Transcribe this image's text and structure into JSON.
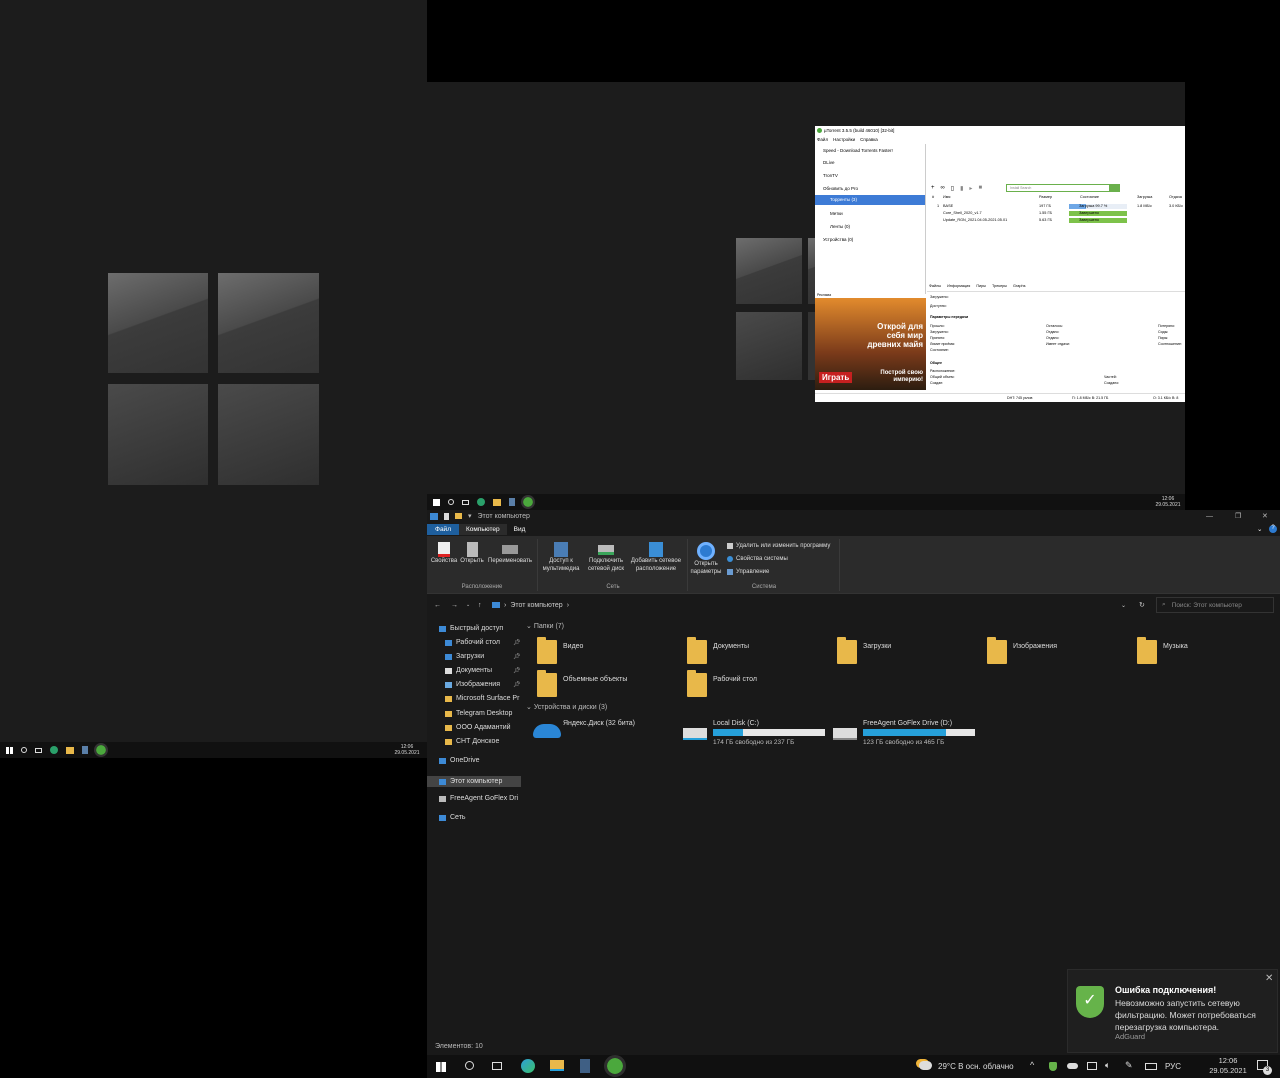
{
  "left_desktop": {
    "clock_time": "12:06",
    "clock_date": "29.05.2021"
  },
  "mid_desktop": {
    "clock_time": "12:06",
    "clock_date": "29.05.2021"
  },
  "utorrent": {
    "title": "µTorrent 3.5.5 (build 46010) [32-bit]",
    "menu": [
      "Файл",
      "Настройки",
      "Справка"
    ],
    "sidebar": [
      {
        "label": "Speed - Download Torrents Faster!",
        "icon": "speed-icon"
      },
      {
        "label": "DLive",
        "icon": "dlive-icon"
      },
      {
        "label": "TronTV",
        "icon": "trontv-icon"
      },
      {
        "label": "Обновить до Pro",
        "icon": "pro-icon"
      },
      {
        "label": "Торренты (3)",
        "icon": "torrents-icon",
        "selected": true
      },
      {
        "label": "Метки",
        "icon": "labels-icon"
      },
      {
        "label": "Ленты (0)",
        "icon": "feeds-icon"
      },
      {
        "label": "Устройства (0)",
        "icon": "devices-icon"
      }
    ],
    "ad_label": "Реклама",
    "search_placeholder": "Install Search",
    "columns": [
      "#",
      "Имя",
      "Размер",
      "Состояние",
      "Загрузка",
      "Отдача"
    ],
    "torrents": [
      {
        "num": "1",
        "name": "BASE",
        "size": "197 ГБ",
        "status": "Загрузка 99.7 %",
        "progress": 0.3,
        "down": "1.8 МБ/с",
        "up": "3.0 КБ/с",
        "color": "#6ea7e6"
      },
      {
        "num": "",
        "name": "Core_Shell_2020_v1.7",
        "size": "1.55 ГБ",
        "status": "Завершено",
        "progress": 1.0,
        "down": "",
        "up": "",
        "color": "#7dc24a"
      },
      {
        "num": "",
        "name": "Update_RGN_2021.04.05-2021.05.01",
        "size": "5.63 ГБ",
        "status": "Завершено",
        "progress": 1.0,
        "down": "",
        "up": "",
        "color": "#7dc24a"
      }
    ],
    "tabs": [
      "Файлы",
      "Информация",
      "Пиры",
      "Трекеры",
      "Graphs"
    ],
    "info_labels": {
      "downloaded": "Загружено:",
      "available": "Доступно:",
      "transfer_header": "Параметры передачи",
      "elapsed": "Прошло:",
      "downloaded2": "Загружено:",
      "received": "Принято:",
      "share_limit": "Лимит приёма:",
      "state": "Состояние:",
      "remaining": "Осталось:",
      "sent": "Отдано:",
      "wasted": "Отдано:",
      "seeds": "Имеет отдачи:",
      "uploaded": "Потеряно:",
      "seeds2": "Сиды:",
      "peers": "Пиры:",
      "ratio": "Соотношение:",
      "general_header": "Общее",
      "location": "Расположение:",
      "total_size": "Общий объем:",
      "created": "Создан:",
      "pieces": "Частей:",
      "created_by": "Создано:"
    },
    "ad_text": {
      "line1": "Открой для",
      "line2": "себя мир",
      "line3": "древних майя",
      "play": "Играть",
      "line4": "Построй свою",
      "line5": "империю!"
    },
    "status_bar": {
      "dht": "DHT: 745 узлов",
      "down": "П: 1.8 МБ/с В: 21.5 ГБ",
      "up": "О: 3.1 КБ/с В: 8"
    }
  },
  "explorer": {
    "title": "Этот компьютер",
    "ribbon_tabs": [
      "Файл",
      "Компьютер",
      "Вид"
    ],
    "ribbon_groups": [
      {
        "name": "Расположение",
        "buttons": [
          "Свойства",
          "Открыть",
          "Переименовать"
        ]
      },
      {
        "name": "Сеть",
        "buttons": [
          "Доступ к мультимедиа",
          "Подключить сетевой диск",
          "Добавить сетевое расположение"
        ]
      },
      {
        "name": "Система",
        "buttons": [
          "Открыть параметры"
        ],
        "links": [
          "Удалить или изменить программу",
          "Свойства системы",
          "Управление"
        ]
      }
    ],
    "address": "Этот компьютер",
    "search_placeholder": "Поиск: Этот компьютер",
    "nav": [
      {
        "label": "Быстрый доступ",
        "icon": "star-icon",
        "pinned": false
      },
      {
        "label": "Рабочий стол",
        "icon": "desktop-icon",
        "pinned": true
      },
      {
        "label": "Загрузки",
        "icon": "downloads-icon",
        "pinned": true
      },
      {
        "label": "Документы",
        "icon": "documents-icon",
        "pinned": true
      },
      {
        "label": "Изображения",
        "icon": "pictures-icon",
        "pinned": true
      },
      {
        "label": "Microsoft Surface Pr",
        "icon": "folder-icon",
        "pinned": false
      },
      {
        "label": "Telegram Desktop",
        "icon": "folder-icon",
        "pinned": false
      },
      {
        "label": "ООО Адамантий",
        "icon": "folder-icon",
        "pinned": false
      },
      {
        "label": "СНТ Донское",
        "icon": "folder-icon",
        "pinned": false
      },
      {
        "label": "OneDrive",
        "icon": "onedrive-icon",
        "pinned": false
      },
      {
        "label": "Этот компьютер",
        "icon": "computer-icon",
        "pinned": false,
        "selected": true
      },
      {
        "label": "FreeAgent GoFlex Dri",
        "icon": "drive-icon",
        "pinned": false
      },
      {
        "label": "Сеть",
        "icon": "network-icon",
        "pinned": false
      }
    ],
    "folders_header": "Папки (7)",
    "folders": [
      "Видео",
      "Документы",
      "Загрузки",
      "Изображения",
      "Музыка",
      "Объемные объекты",
      "Рабочий стол"
    ],
    "devices_header": "Устройства и диски (3)",
    "devices": [
      {
        "name": "Яндекс.Диск (32 бита)",
        "icon": "yandex-disk-icon",
        "free": "",
        "used_fraction": null
      },
      {
        "name": "Local Disk (C:)",
        "icon": "system-drive-icon",
        "free": "174 ГБ свободно из 237 ГБ",
        "used_fraction": 0.27
      },
      {
        "name": "FreeAgent GoFlex Drive (D:)",
        "icon": "external-drive-icon",
        "free": "123 ГБ свободно из 465 ГБ",
        "used_fraction": 0.74
      }
    ],
    "status": "Элементов: 10"
  },
  "taskbar": {
    "weather": "29°C  В осн. облачно",
    "lang": "РУС",
    "time": "12:06",
    "date": "29.05.2021",
    "notif_count": "3"
  },
  "toast": {
    "title": "Ошибка подключения!",
    "body": "Невозможно запустить сетевую фильтрацию. Может потребоваться перезагрузка компьютера.",
    "app": "AdGuard"
  },
  "colors": {
    "accent": "#26a0da",
    "toast_shield": "#66b34a",
    "utorrent_selected": "#3d7bd6"
  }
}
